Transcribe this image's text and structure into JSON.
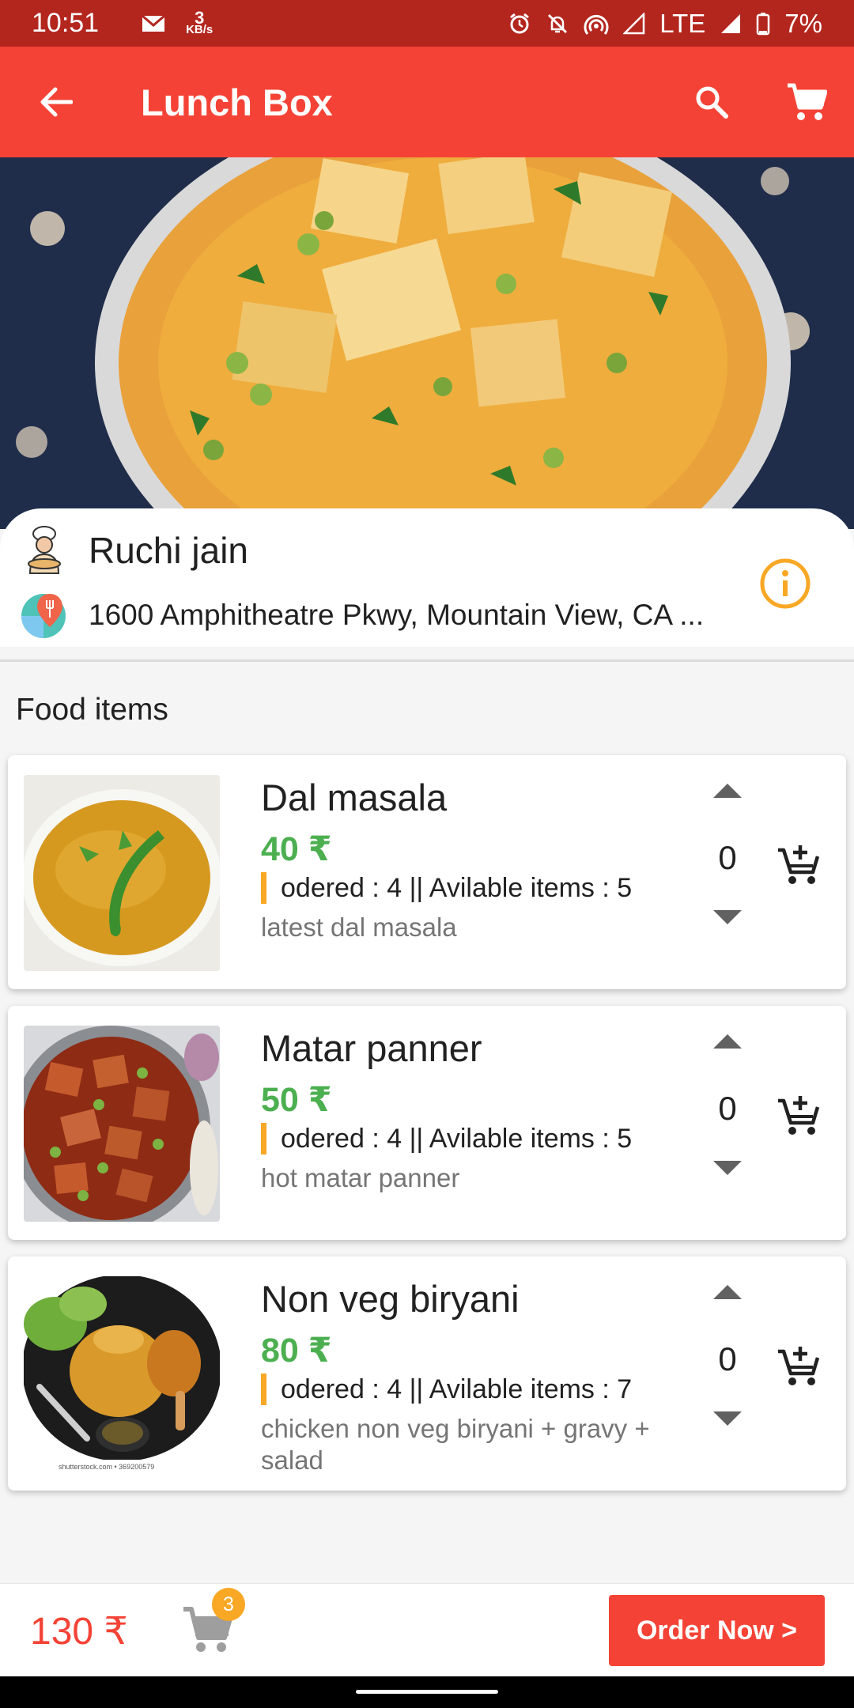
{
  "status_bar": {
    "time": "10:51",
    "speed_value": "3",
    "speed_unit": "KB/s",
    "network": "LTE",
    "battery": "7%"
  },
  "app_bar": {
    "title": "Lunch Box",
    "icons": [
      "back-arrow-icon",
      "search-icon",
      "cart-icon"
    ]
  },
  "vendor": {
    "name": "Ruchi jain",
    "address": "1600 Amphitheatre Pkwy, Mountain View, CA ...",
    "icons": [
      "chef-icon",
      "map-pin-icon",
      "info-icon"
    ]
  },
  "section": {
    "title": "Food items"
  },
  "food_items": [
    {
      "name": "Dal masala",
      "price": "40 ₹",
      "meta": "odered : 4 || Avilable items : 5",
      "description": "latest dal masala",
      "quantity": "0"
    },
    {
      "name": "Matar panner",
      "price": "50 ₹",
      "meta": "odered : 4 || Avilable items : 5",
      "description": "hot matar panner",
      "quantity": "0"
    },
    {
      "name": "Non veg biryani",
      "price": "80 ₹",
      "meta": "odered : 4 || Avilable items : 7",
      "description": "chicken non veg biryani + gravy + salad",
      "quantity": "0"
    }
  ],
  "bottom_bar": {
    "total": "130 ₹",
    "cart_count": "3",
    "order_label": "Order Now >"
  },
  "colors": {
    "primary": "#f44336",
    "status_bar": "#b3261e",
    "price_green": "#4caf50",
    "accent_amber": "#f9a825"
  }
}
